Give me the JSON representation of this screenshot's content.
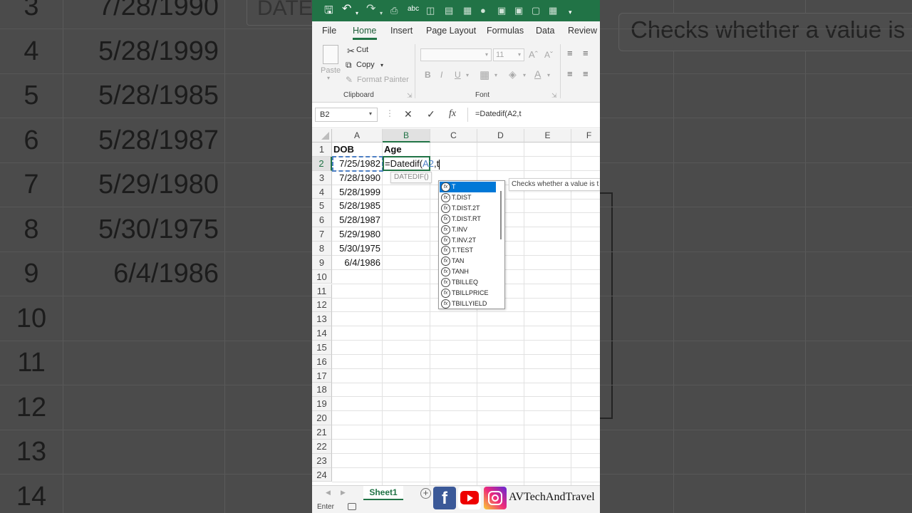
{
  "background": {
    "tooltip_text": "Checks whether a value is t",
    "datedif_hint": "DATED",
    "rows": [
      {
        "num": "3",
        "date": "7/28/1990"
      },
      {
        "num": "4",
        "date": "5/28/1999"
      },
      {
        "num": "5",
        "date": "5/28/1985"
      },
      {
        "num": "6",
        "date": "5/28/1987"
      },
      {
        "num": "7",
        "date": "5/29/1980"
      },
      {
        "num": "8",
        "date": "5/30/1975"
      },
      {
        "num": "9",
        "date": "6/4/1986"
      },
      {
        "num": "10",
        "date": ""
      },
      {
        "num": "11",
        "date": ""
      },
      {
        "num": "12",
        "date": ""
      },
      {
        "num": "13",
        "date": ""
      },
      {
        "num": "14",
        "date": ""
      }
    ]
  },
  "ribbon_tabs": [
    "File",
    "Home",
    "Insert",
    "Page Layout",
    "Formulas",
    "Data",
    "Review"
  ],
  "clipboard": {
    "paste": "Paste",
    "cut": "Cut",
    "copy": "Copy",
    "format_painter": "Format Painter",
    "label": "Clipboard"
  },
  "font": {
    "label": "Font",
    "size": "11",
    "bold": "B",
    "italic": "I",
    "underline": "U"
  },
  "formula_bar": {
    "name_box": "B2",
    "formula": "=Datedif(A2,t",
    "fx": "fx"
  },
  "columns": [
    "A",
    "B",
    "C",
    "D",
    "E",
    "F"
  ],
  "rows": [
    "1",
    "2",
    "3",
    "4",
    "5",
    "6",
    "7",
    "8",
    "9",
    "10",
    "11",
    "12",
    "13",
    "14",
    "15",
    "16",
    "17",
    "18",
    "19",
    "20",
    "21",
    "22",
    "23",
    "24"
  ],
  "cells": {
    "A1": "DOB",
    "B1": "Age",
    "A2": "7/25/1982",
    "A3": "7/28/1990",
    "A4": "5/28/1999",
    "A5": "5/28/1985",
    "A6": "5/28/1987",
    "A7": "5/29/1980",
    "A8": "5/30/1975",
    "A9": "6/4/1986"
  },
  "editing": {
    "prefix": "=Datedif(",
    "ref": "A2",
    "suffix": ",t",
    "hint": "DATEDIF()"
  },
  "autocomplete": {
    "items": [
      "T",
      "T.DIST",
      "T.DIST.2T",
      "T.DIST.RT",
      "T.INV",
      "T.INV.2T",
      "T.TEST",
      "TAN",
      "TANH",
      "TBILLEQ",
      "TBILLPRICE",
      "TBILLYIELD"
    ],
    "tooltip": "Checks whether a value is t"
  },
  "sheet": {
    "tab": "Sheet1",
    "add": "+",
    "status": "Enter"
  },
  "social": {
    "handle": "AVTechAndTravel",
    "fb": "f"
  },
  "colors": {
    "excel_green": "#217346",
    "selection_blue": "#0078d7",
    "ref_blue": "#4d7fc4"
  }
}
